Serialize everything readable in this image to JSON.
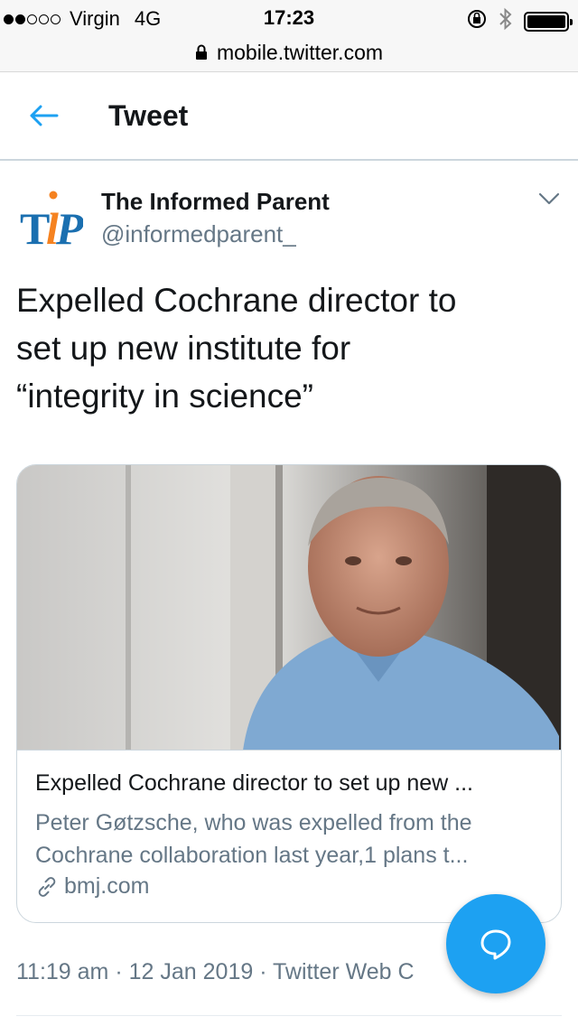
{
  "status_bar": {
    "carrier": "Virgin",
    "network": "4G",
    "time": "17:23",
    "signal_bars_filled": 2,
    "signal_bars_total": 5,
    "battery_level": 1.0
  },
  "url_bar": {
    "url": "mobile.twitter.com"
  },
  "header": {
    "title": "Tweet"
  },
  "author": {
    "name": "The Informed Parent",
    "handle": "@informedparent_",
    "avatar_text": "TIP",
    "avatar_colors": {
      "t": "#1a6fb0",
      "i": "#f58220",
      "p": "#1a6fb0"
    }
  },
  "tweet": {
    "text_lines": [
      "Expelled Cochrane director to",
      "set up new institute for",
      "“integrity in science”"
    ]
  },
  "card": {
    "title": "Expelled Cochrane director to set up new ...",
    "description_lines": [
      "Peter Gøtzsche, who was expelled from the",
      "Cochrane collaboration last year,1 plans t..."
    ],
    "domain": "bmj.com"
  },
  "meta": {
    "time": "11:19 am",
    "date": "12 Jan 2019",
    "source": "Twitter Web C"
  },
  "colors": {
    "accent": "#1da1f2",
    "text": "#14171a",
    "secondary": "#657786",
    "border": "#ccd6dd"
  },
  "icons": [
    "lock-icon",
    "back-arrow-icon",
    "chevron-down-icon",
    "link-icon",
    "compose-reply-icon",
    "bluetooth-icon",
    "rotation-lock-icon",
    "battery-icon"
  ]
}
